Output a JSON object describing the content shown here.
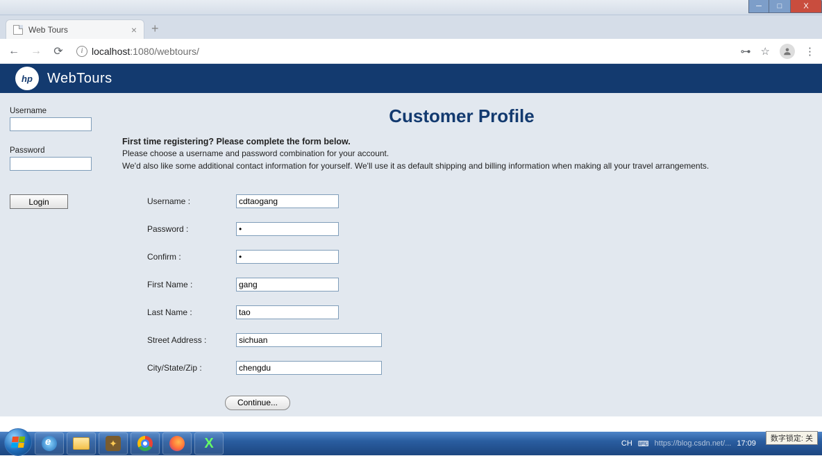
{
  "window": {
    "min": "─",
    "max": "□",
    "close": "X"
  },
  "tab": {
    "title": "Web Tours",
    "close": "×",
    "new": "+"
  },
  "nav": {
    "back": "←",
    "forward": "→",
    "reload": "⟳",
    "info": "i",
    "host": "localhost",
    "port_path": ":1080/webtours/",
    "key": "⊶",
    "star": "☆",
    "menu": "⋮"
  },
  "brand": {
    "logo": "hp",
    "name_a": "Web",
    "name_b": "Tours"
  },
  "sidebar": {
    "user_label": "Username",
    "pass_label": "Password",
    "login": "Login"
  },
  "main": {
    "title": "Customer Profile",
    "intro_bold": "First time registering? Please complete the form below.",
    "intro_l1": "Please choose a username and password combination for your account.",
    "intro_l2": "We'd also like some additional contact information for yourself. We'll use it as default shipping and billing information when making all your travel arrangements."
  },
  "form": {
    "username": {
      "label": "Username :",
      "value": "cdtaogang"
    },
    "password": {
      "label": "Password :",
      "value": "•"
    },
    "confirm": {
      "label": "Confirm :",
      "value": "•"
    },
    "first": {
      "label": "First Name :",
      "value": "gang"
    },
    "last": {
      "label": "Last Name :",
      "value": "tao"
    },
    "street": {
      "label": "Street Address :",
      "value": "sichuan"
    },
    "city": {
      "label": "City/State/Zip :",
      "value": "chengdu"
    },
    "continue": "Continue..."
  },
  "taskbar": {
    "lang": "CH",
    "watermark": "https://blog.csdn.net/...",
    "lock": "数字锁定: 关",
    "time": "17:09",
    "date": "..."
  }
}
